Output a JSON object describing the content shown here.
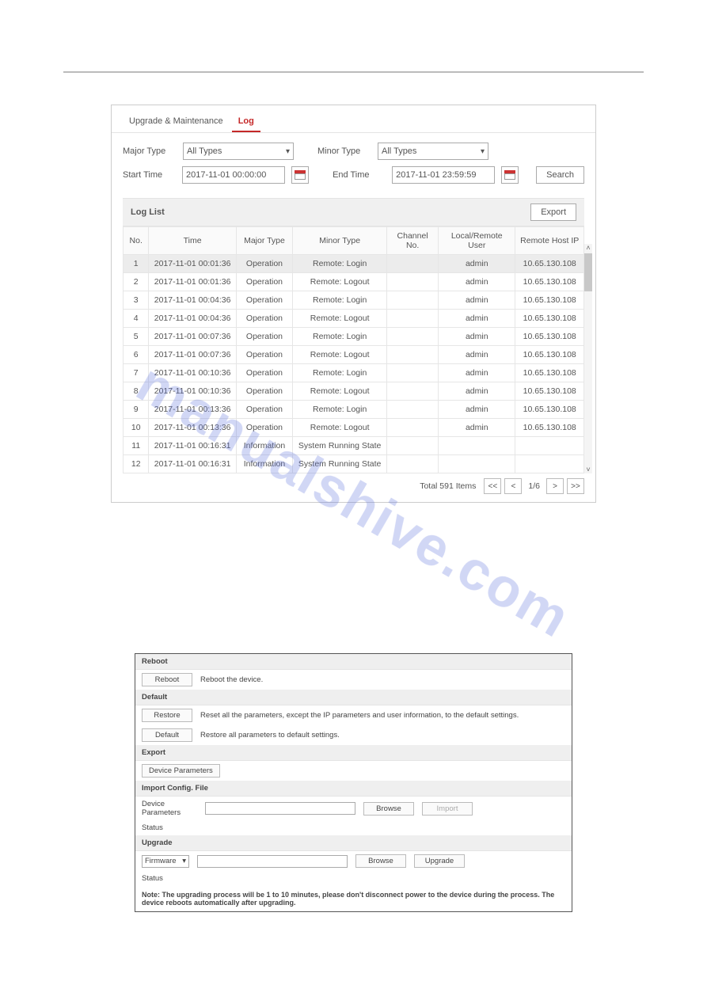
{
  "watermark": "manualshive.com",
  "tabs": {
    "t1": "Upgrade & Maintenance",
    "t2": "Log"
  },
  "filters": {
    "major_label": "Major Type",
    "major_value": "All Types",
    "minor_label": "Minor Type",
    "minor_value": "All Types",
    "start_label": "Start Time",
    "start_value": "2017-11-01 00:00:00",
    "end_label": "End Time",
    "end_value": "2017-11-01 23:59:59",
    "search_btn": "Search"
  },
  "loglist": {
    "title": "Log List",
    "export_btn": "Export",
    "cols": {
      "no": "No.",
      "time": "Time",
      "major": "Major Type",
      "minor": "Minor Type",
      "channel": "Channel No.",
      "user": "Local/Remote User",
      "ip": "Remote Host IP"
    },
    "rows": [
      {
        "no": "1",
        "time": "2017-11-01 00:01:36",
        "major": "Operation",
        "minor": "Remote: Login",
        "channel": "",
        "user": "admin",
        "ip": "10.65.130.108"
      },
      {
        "no": "2",
        "time": "2017-11-01 00:01:36",
        "major": "Operation",
        "minor": "Remote: Logout",
        "channel": "",
        "user": "admin",
        "ip": "10.65.130.108"
      },
      {
        "no": "3",
        "time": "2017-11-01 00:04:36",
        "major": "Operation",
        "minor": "Remote: Login",
        "channel": "",
        "user": "admin",
        "ip": "10.65.130.108"
      },
      {
        "no": "4",
        "time": "2017-11-01 00:04:36",
        "major": "Operation",
        "minor": "Remote: Logout",
        "channel": "",
        "user": "admin",
        "ip": "10.65.130.108"
      },
      {
        "no": "5",
        "time": "2017-11-01 00:07:36",
        "major": "Operation",
        "minor": "Remote: Login",
        "channel": "",
        "user": "admin",
        "ip": "10.65.130.108"
      },
      {
        "no": "6",
        "time": "2017-11-01 00:07:36",
        "major": "Operation",
        "minor": "Remote: Logout",
        "channel": "",
        "user": "admin",
        "ip": "10.65.130.108"
      },
      {
        "no": "7",
        "time": "2017-11-01 00:10:36",
        "major": "Operation",
        "minor": "Remote: Login",
        "channel": "",
        "user": "admin",
        "ip": "10.65.130.108"
      },
      {
        "no": "8",
        "time": "2017-11-01 00:10:36",
        "major": "Operation",
        "minor": "Remote: Logout",
        "channel": "",
        "user": "admin",
        "ip": "10.65.130.108"
      },
      {
        "no": "9",
        "time": "2017-11-01 00:13:36",
        "major": "Operation",
        "minor": "Remote: Login",
        "channel": "",
        "user": "admin",
        "ip": "10.65.130.108"
      },
      {
        "no": "10",
        "time": "2017-11-01 00:13:36",
        "major": "Operation",
        "minor": "Remote: Logout",
        "channel": "",
        "user": "admin",
        "ip": "10.65.130.108"
      },
      {
        "no": "11",
        "time": "2017-11-01 00:16:31",
        "major": "Information",
        "minor": "System Running State",
        "channel": "",
        "user": "",
        "ip": ""
      },
      {
        "no": "12",
        "time": "2017-11-01 00:16:31",
        "major": "Information",
        "minor": "System Running State",
        "channel": "",
        "user": "",
        "ip": ""
      }
    ]
  },
  "pager": {
    "total": "Total 591 Items",
    "first": "<<",
    "prev": "<",
    "current": "1/6",
    "next": ">",
    "last": ">>"
  },
  "maint": {
    "reboot_h": "Reboot",
    "reboot_btn": "Reboot",
    "reboot_desc": "Reboot the device.",
    "default_h": "Default",
    "restore_btn": "Restore",
    "restore_desc": "Reset all the parameters, except the IP parameters and user information, to the default settings.",
    "default_btn": "Default",
    "default_desc": "Restore all parameters to default settings.",
    "export_h": "Export",
    "devparam_btn": "Device Parameters",
    "import_h": "Import Config. File",
    "import_label": "Device Parameters",
    "browse_btn": "Browse",
    "import_btn": "Import",
    "status_label": "Status",
    "upgrade_h": "Upgrade",
    "upgrade_src": "Firmware",
    "upgrade_btn": "Upgrade",
    "note": "Note: The upgrading process will be 1 to 10 minutes, please don't disconnect power to the device during the process. The device reboots automatically after upgrading."
  }
}
